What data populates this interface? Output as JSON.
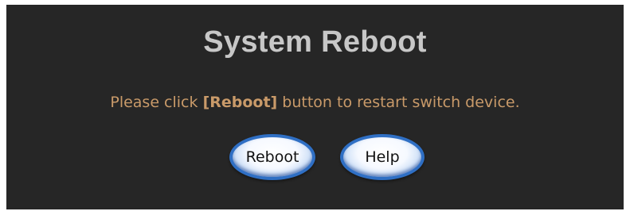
{
  "page": {
    "title": "System Reboot",
    "message": {
      "before": "Please click ",
      "emphasis": "[Reboot]",
      "after": " button to restart switch device."
    }
  },
  "buttons": {
    "reboot_label": "Reboot",
    "help_label": "Help"
  },
  "colors": {
    "panel_background": "#262626",
    "title_text": "#c7c7c7",
    "message_text": "#c99a69",
    "button_border": "#2f6fc4"
  }
}
